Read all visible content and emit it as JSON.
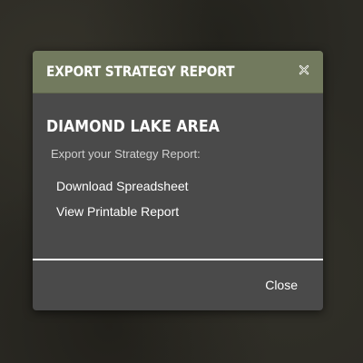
{
  "modal": {
    "title": "EXPORT STRATEGY REPORT",
    "close_icon": "close-x-icon",
    "area_title": "DIAMOND LAKE AREA",
    "subtitle": "Export your Strategy Report:",
    "links": [
      {
        "label": "Download Spreadsheet"
      },
      {
        "label": "View Printable Report"
      }
    ],
    "close_label": "Close"
  },
  "colors": {
    "header_bg": "#727a5e",
    "body_bg": "#4a4a4a",
    "page_bg": "#2b2a24",
    "text": "#ffffff"
  }
}
